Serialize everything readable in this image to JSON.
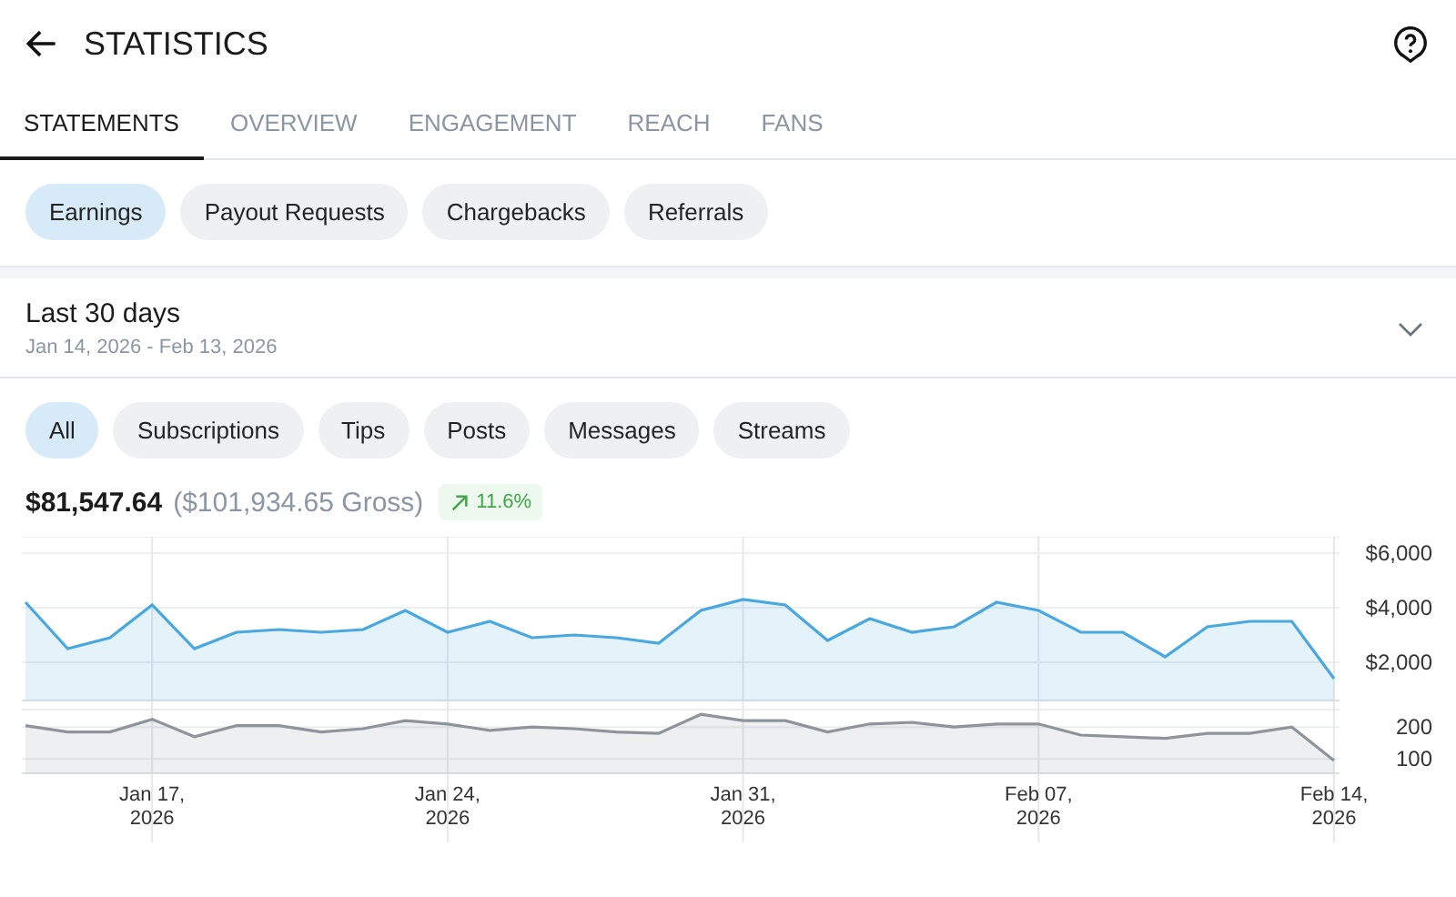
{
  "header": {
    "title": "STATISTICS"
  },
  "tabs": [
    {
      "label": "STATEMENTS",
      "selected": true
    },
    {
      "label": "OVERVIEW",
      "selected": false
    },
    {
      "label": "ENGAGEMENT",
      "selected": false
    },
    {
      "label": "REACH",
      "selected": false
    },
    {
      "label": "FANS",
      "selected": false
    }
  ],
  "statement_types": [
    {
      "label": "Earnings",
      "selected": true
    },
    {
      "label": "Payout Requests",
      "selected": false
    },
    {
      "label": "Chargebacks",
      "selected": false
    },
    {
      "label": "Referrals",
      "selected": false
    }
  ],
  "period": {
    "label": "Last 30 days",
    "range": "Jan 14, 2026 - Feb 13, 2026"
  },
  "categories": [
    {
      "label": "All",
      "selected": true
    },
    {
      "label": "Subscriptions",
      "selected": false
    },
    {
      "label": "Tips",
      "selected": false
    },
    {
      "label": "Posts",
      "selected": false
    },
    {
      "label": "Messages",
      "selected": false
    },
    {
      "label": "Streams",
      "selected": false
    }
  ],
  "summary": {
    "net": "$81,547.64",
    "gross": "($101,934.65 Gross)",
    "change": "11.6%"
  },
  "charts": [
    {
      "chart_data": {
        "type": "area",
        "grid": true,
        "ylim": [
          600,
          6600
        ],
        "yticks": [
          {
            "value": 2000,
            "label": "$2,000"
          },
          {
            "value": 4000,
            "label": "$4,000"
          },
          {
            "value": 6000,
            "label": "$6,000"
          }
        ],
        "series": [
          {
            "color": "#4aa8e0",
            "values": [
              4200,
              2500,
              2900,
              4100,
              2500,
              3100,
              3200,
              3100,
              3200,
              3900,
              3100,
              3500,
              2900,
              3000,
              2900,
              2700,
              3900,
              4300,
              4100,
              2800,
              3600,
              3100,
              3300,
              4200,
              3900,
              3100,
              3100,
              2200,
              3300,
              3500,
              3500,
              1400
            ]
          }
        ]
      }
    },
    {
      "chart_data": {
        "type": "area",
        "grid": true,
        "categories": [
          null,
          null,
          null,
          "Jan 17, 2026",
          null,
          null,
          null,
          null,
          null,
          null,
          "Jan 24, 2026",
          null,
          null,
          null,
          null,
          null,
          null,
          "Jan 31, 2026",
          null,
          null,
          null,
          null,
          null,
          null,
          "Feb 07, 2026",
          null,
          null,
          null,
          null,
          null,
          null,
          "Feb 14, 2026"
        ],
        "ylim": [
          55,
          255
        ],
        "yticks": [
          100,
          200
        ],
        "series": [
          {
            "color": "#8e949c",
            "values": [
              205,
              185,
              185,
              225,
              170,
              205,
              205,
              185,
              195,
              220,
              210,
              190,
              200,
              195,
              185,
              180,
              240,
              220,
              220,
              185,
              210,
              215,
              200,
              210,
              210,
              175,
              170,
              165,
              180,
              180,
              200,
              95
            ]
          }
        ]
      }
    }
  ]
}
